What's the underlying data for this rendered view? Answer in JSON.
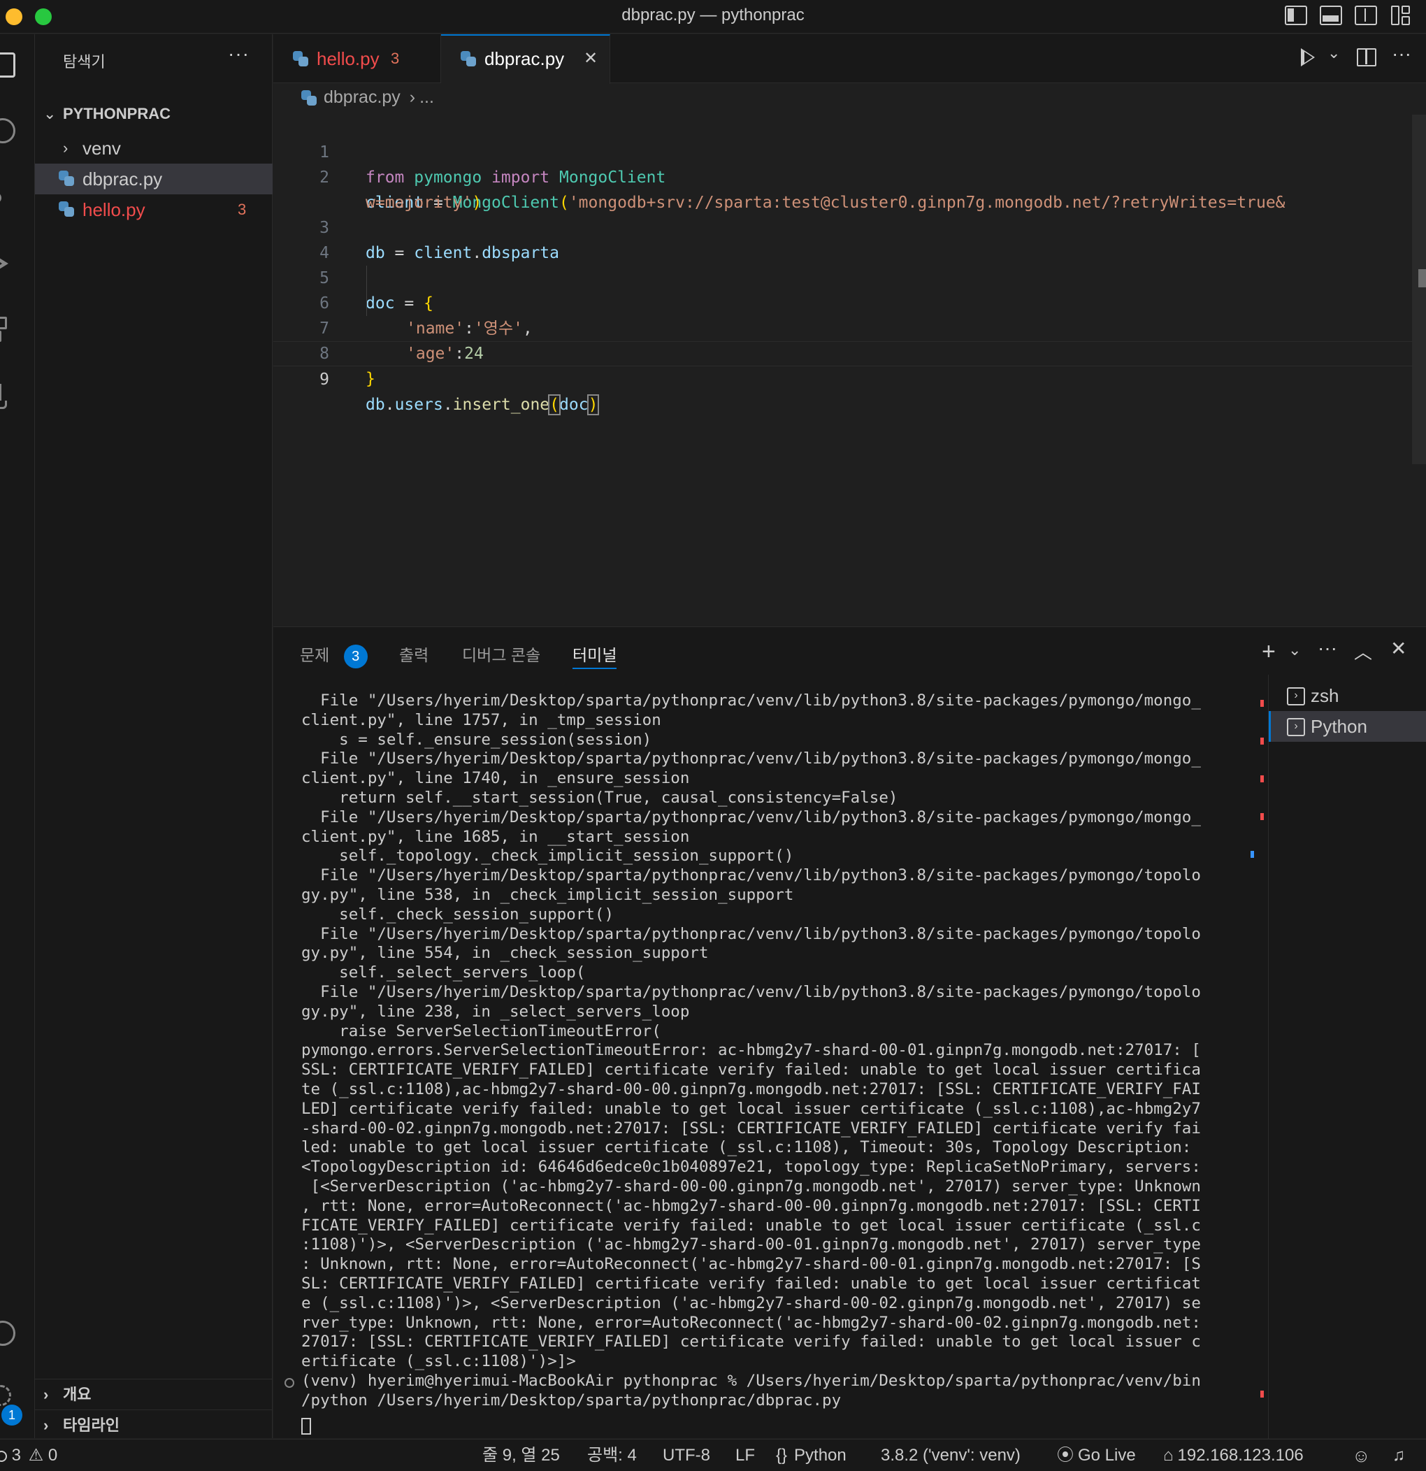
{
  "window": {
    "title": "dbprac.py — pythonprac"
  },
  "sidebar": {
    "title": "탐색기",
    "more": "···",
    "folder": "PYTHONPRAC",
    "items": [
      {
        "label": "venv"
      },
      {
        "label": "dbprac.py"
      },
      {
        "label": "hello.py",
        "badge": "3"
      }
    ],
    "outline": "개요",
    "timeline": "타임라인"
  },
  "tabs": [
    {
      "label": "hello.py",
      "badge": "3"
    },
    {
      "label": "dbprac.py",
      "close": "✕"
    }
  ],
  "breadcrumb": {
    "file": "dbprac.py",
    "sep": "›",
    "rest": "..."
  },
  "editor": {
    "line_numbers": [
      "1",
      "2",
      "3",
      "4",
      "5",
      "6",
      "7",
      "8",
      "9"
    ],
    "code": {
      "l1": [
        "from",
        "pymongo",
        "import",
        "MongoClient"
      ],
      "l2a": [
        "client",
        " = ",
        "MongoClient",
        "(",
        "'mongodb+srv://sparta:test@cluster0.ginpn7g.mongodb.net/?retryWrites=true&"
      ],
      "l2b": [
        "w=majority'",
        ")"
      ],
      "l3": [
        "db",
        " = ",
        "client",
        ".",
        "dbsparta"
      ],
      "l5": [
        "doc",
        " = ",
        "{"
      ],
      "l6": [
        "'name'",
        ":",
        "'영수'",
        ","
      ],
      "l7": [
        "'age'",
        ":",
        "24"
      ],
      "l8": [
        "}"
      ],
      "l9": [
        "db",
        ".",
        "users",
        ".",
        "insert_one",
        "(",
        "doc",
        ")"
      ]
    }
  },
  "panel": {
    "tabs": [
      "문제",
      "출력",
      "디버그 콘솔",
      "터미널"
    ],
    "problems_count": "3",
    "terminal_lines": [
      "  File \"/Users/hyerim/Desktop/sparta/pythonprac/venv/lib/python3.8/site-packages/pymongo/mongo_",
      "client.py\", line 1757, in _tmp_session",
      "    s = self._ensure_session(session)",
      "  File \"/Users/hyerim/Desktop/sparta/pythonprac/venv/lib/python3.8/site-packages/pymongo/mongo_",
      "client.py\", line 1740, in _ensure_session",
      "    return self.__start_session(True, causal_consistency=False)",
      "  File \"/Users/hyerim/Desktop/sparta/pythonprac/venv/lib/python3.8/site-packages/pymongo/mongo_",
      "client.py\", line 1685, in __start_session",
      "    self._topology._check_implicit_session_support()",
      "  File \"/Users/hyerim/Desktop/sparta/pythonprac/venv/lib/python3.8/site-packages/pymongo/topolo",
      "gy.py\", line 538, in _check_implicit_session_support",
      "    self._check_session_support()",
      "  File \"/Users/hyerim/Desktop/sparta/pythonprac/venv/lib/python3.8/site-packages/pymongo/topolo",
      "gy.py\", line 554, in _check_session_support",
      "    self._select_servers_loop(",
      "  File \"/Users/hyerim/Desktop/sparta/pythonprac/venv/lib/python3.8/site-packages/pymongo/topolo",
      "gy.py\", line 238, in _select_servers_loop",
      "    raise ServerSelectionTimeoutError(",
      "pymongo.errors.ServerSelectionTimeoutError: ac-hbmg2y7-shard-00-01.ginpn7g.mongodb.net:27017: [",
      "SSL: CERTIFICATE_VERIFY_FAILED] certificate verify failed: unable to get local issuer certifica",
      "te (_ssl.c:1108),ac-hbmg2y7-shard-00-00.ginpn7g.mongodb.net:27017: [SSL: CERTIFICATE_VERIFY_FAI",
      "LED] certificate verify failed: unable to get local issuer certificate (_ssl.c:1108),ac-hbmg2y7",
      "-shard-00-02.ginpn7g.mongodb.net:27017: [SSL: CERTIFICATE_VERIFY_FAILED] certificate verify fai",
      "led: unable to get local issuer certificate (_ssl.c:1108), Timeout: 30s, Topology Description:",
      "<TopologyDescription id: 64646d6edce0c1b040897e21, topology_type: ReplicaSetNoPrimary, servers:",
      " [<ServerDescription ('ac-hbmg2y7-shard-00-00.ginpn7g.mongodb.net', 27017) server_type: Unknown",
      ", rtt: None, error=AutoReconnect('ac-hbmg2y7-shard-00-00.ginpn7g.mongodb.net:27017: [SSL: CERTI",
      "FICATE_VERIFY_FAILED] certificate verify failed: unable to get local issuer certificate (_ssl.c",
      ":1108)')>, <ServerDescription ('ac-hbmg2y7-shard-00-01.ginpn7g.mongodb.net', 27017) server_type",
      ": Unknown, rtt: None, error=AutoReconnect('ac-hbmg2y7-shard-00-01.ginpn7g.mongodb.net:27017: [S",
      "SL: CERTIFICATE_VERIFY_FAILED] certificate verify failed: unable to get local issuer certificat",
      "e (_ssl.c:1108)')>, <ServerDescription ('ac-hbmg2y7-shard-00-02.ginpn7g.mongodb.net', 27017) se",
      "rver_type: Unknown, rtt: None, error=AutoReconnect('ac-hbmg2y7-shard-00-02.ginpn7g.mongodb.net:",
      "27017: [SSL: CERTIFICATE_VERIFY_FAILED] certificate verify failed: unable to get local issuer c",
      "ertificate (_ssl.c:1108)')>]>",
      "(venv) hyerim@hyerimui-MacBookAir pythonprac % /Users/hyerim/Desktop/sparta/pythonprac/venv/bin",
      "/python /Users/hyerim/Desktop/sparta/pythonprac/dbprac.py"
    ],
    "terminals": [
      "zsh",
      "Python"
    ]
  },
  "statusbar": {
    "errors": "3",
    "warnings": "0",
    "accounts_badge": "1",
    "position": "줄 9, 열 25",
    "spaces": "공백: 4",
    "encoding": "UTF-8",
    "eol": "LF",
    "language": "Python",
    "interpreter": "3.8.2 ('venv': venv)",
    "golive": "Go Live",
    "ip": "192.168.123.106"
  },
  "colors": {
    "accent": "#0078d4",
    "error": "#f14c4c",
    "modified": "#e2735c",
    "background": "#1f1f1f"
  }
}
